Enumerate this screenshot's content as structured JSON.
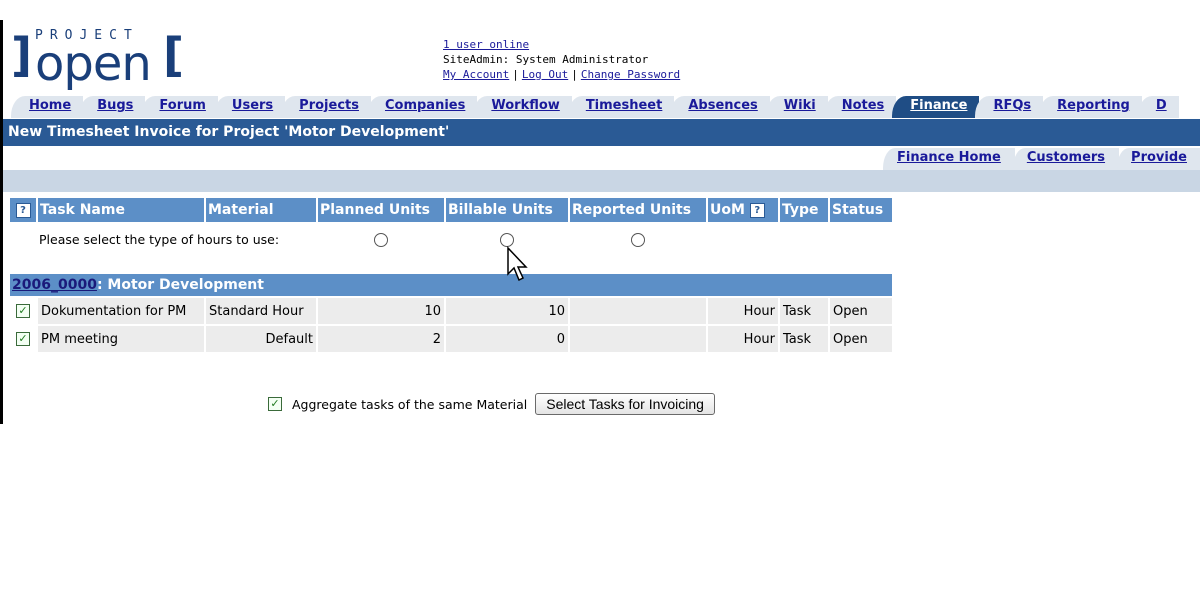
{
  "logo": {
    "top": "PROJECT",
    "main": "open"
  },
  "user": {
    "online": "1 user online",
    "site_admin": "SiteAdmin: System Administrator",
    "my_account": "My Account",
    "logout": "Log Out",
    "change_password": "Change Password",
    "separator": "|"
  },
  "tabs": [
    "Home",
    "Bugs",
    "Forum",
    "Users",
    "Projects",
    "Companies",
    "Workflow",
    "Timesheet",
    "Absences",
    "Wiki",
    "Notes",
    "Finance",
    "RFQs",
    "Reporting",
    "D"
  ],
  "page_title": "New Timesheet Invoice for Project 'Motor Development'",
  "subtabs": [
    "Finance Home",
    "Customers",
    "Provide"
  ],
  "table": {
    "headers": [
      "Task Name",
      "Material",
      "Planned Units",
      "Billable Units",
      "Reported Units",
      "UoM",
      "Type",
      "Status"
    ],
    "help_glyph": "?",
    "select_text": "Please select the type of hours to use:",
    "section_code": "2006_0000",
    "section_name": ": Motor Development",
    "rows": [
      {
        "task": "Dokumentation for PM",
        "material": "Standard Hour",
        "planned": "10",
        "billable": "10",
        "reported": "",
        "uom": "Hour",
        "type": "Task",
        "status": "Open"
      },
      {
        "task": "PM meeting",
        "material": "Default",
        "planned": "2",
        "billable": "0",
        "reported": "",
        "uom": "Hour",
        "type": "Task",
        "status": "Open"
      }
    ]
  },
  "aggregate_label": "Aggregate tasks of the same Material",
  "submit_label": "Select Tasks for Invoicing",
  "colors": {
    "header_blue": "#5c8fc7",
    "title_blue": "#2a5a95",
    "link": "#1a1a9a"
  }
}
